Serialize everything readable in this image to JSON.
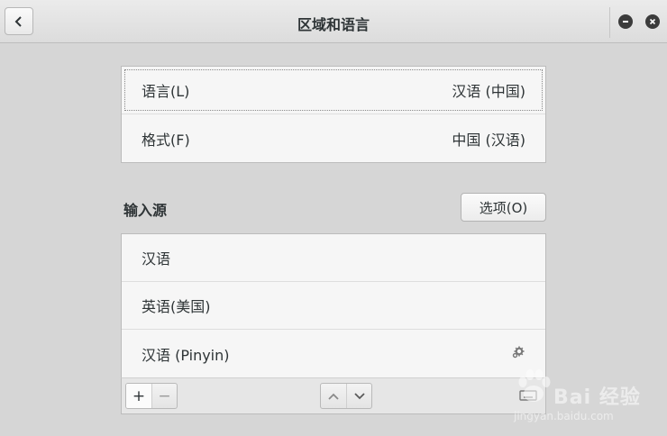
{
  "header": {
    "title": "区域和语言"
  },
  "language_panel": {
    "rows": [
      {
        "label": "语言(L)",
        "value": "汉语 (中国)"
      },
      {
        "label": "格式(F)",
        "value": "中国 (汉语)"
      }
    ]
  },
  "input_sources": {
    "title": "输入源",
    "options_label": "选项(O)",
    "items": [
      {
        "label": "汉语"
      },
      {
        "label": "英语(美国)"
      },
      {
        "label": "汉语 (Pinyin)"
      }
    ],
    "toolbar": {
      "add": "+",
      "remove": "−"
    }
  },
  "watermark": {
    "text": "Bai 经验",
    "sub": "jingyan.baidu.com"
  }
}
